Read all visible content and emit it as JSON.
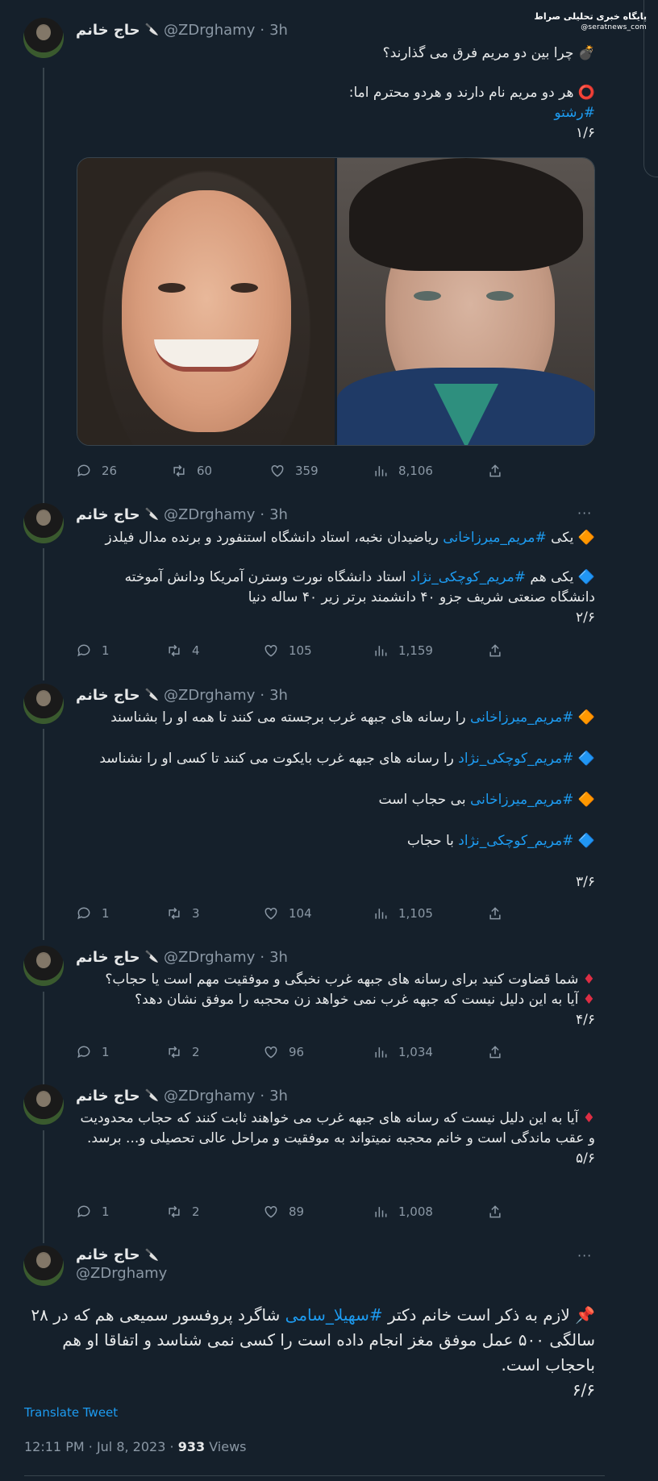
{
  "watermark": {
    "line1": "پایگاه خبری تحلیلی صراط",
    "line2": "@seratnews_com"
  },
  "user": {
    "name": "حاج خانم",
    "knife": "🔪",
    "handle": "@ZDrghamy",
    "sep": "·",
    "time": "3h"
  },
  "more_label": "···",
  "tweets": [
    {
      "lines": [
        "💣 چرا بین دو مریم فرق می گذارند؟",
        "⭕ هر دو مریم نام دارند و هردو محترم اما:",
        "#رشتو",
        "۱/۶"
      ],
      "stats": {
        "reply": "26",
        "retweet": "60",
        "like": "359",
        "views": "8,106"
      }
    },
    {
      "p1_pre": "یکی ",
      "p1_tag": "#مریم_میرزاخانی",
      "p1_post": " ریاضیدان نخبه، استاد دانشگاه استنفورد و برنده مدال فیلدز",
      "p2_pre": "یکی هم ",
      "p2_tag": "#مریم_کوچکی_نژاد",
      "p2_post": " استاد دانشگاه نورت وسترن آمریکا ودانش آموخته دانشگاه صنعتی شریف جزو ۴۰ دانشمند برتر زیر ۴۰ ساله دنیا",
      "num": "۲/۶",
      "stats": {
        "reply": "1",
        "retweet": "4",
        "like": "105",
        "views": "1,159"
      }
    },
    {
      "l1_tag": "#مریم_میرزاخانی",
      "l1_text": " را رسانه های جبهه غرب برجسته می کنند تا همه او را بشناسند",
      "l2_tag": "#مریم_کوچکی_نژاد",
      "l2_text": " را رسانه های جبهه غرب بایکوت می کنند تا کسی او را نشناسد",
      "l3_tag": "#مریم_میرزاخانی",
      "l3_text": " بی حجاب است",
      "l4_tag": "#مریم_کوچکی_نژاد",
      "l4_text": " با حجاب",
      "num": "۳/۶",
      "stats": {
        "reply": "1",
        "retweet": "3",
        "like": "104",
        "views": "1,105"
      }
    },
    {
      "l1": "شما قضاوت کنید برای رسانه های جبهه غرب نخبگی و موفقیت مهم است یا حجاب؟",
      "l2": "آیا به این دلیل نیست که جبهه غرب نمی خواهد زن محجبه را موفق نشان دهد؟",
      "num": "۴/۶",
      "stats": {
        "reply": "1",
        "retweet": "2",
        "like": "96",
        "views": "1,034"
      }
    },
    {
      "l1": "آیا به این دلیل نیست که رسانه های جبهه غرب می خواهند ثابت کنند که حجاب محدودیت و عقب ماندگی است و خانم محجبه نمیتواند به موفقیت و مراحل عالی تحصیلی و... برسد.",
      "num": "۵/۶",
      "stats": {
        "reply": "1",
        "retweet": "2",
        "like": "89",
        "views": "1,008"
      }
    },
    {
      "pre": "📌 لازم به ذکر است خانم دکتر ",
      "tag": "#سهیلا_سامی",
      "post": " شاگرد پروفسور سمیعی هم که در ۲۸ سالگی ۵۰۰ عمل موفق مغز انجام داده است را کسی نمی شناسد و اتفاقا او هم باحجاب است.",
      "num": "۶/۶"
    }
  ],
  "translate_label": "Translate Tweet",
  "footer": {
    "time": "12:11 PM",
    "sep": "·",
    "date": "Jul 8, 2023",
    "views_count": "933",
    "views_label": "Views"
  },
  "icons": {
    "diamond_orange": "🔶",
    "diamond_blue": "🔷",
    "diamond_red": "♦"
  },
  "colors": {
    "background": "#15202b",
    "text": "#e7e9ea",
    "muted": "#8b98a5",
    "link": "#1d9bf0",
    "border": "#38444d"
  }
}
